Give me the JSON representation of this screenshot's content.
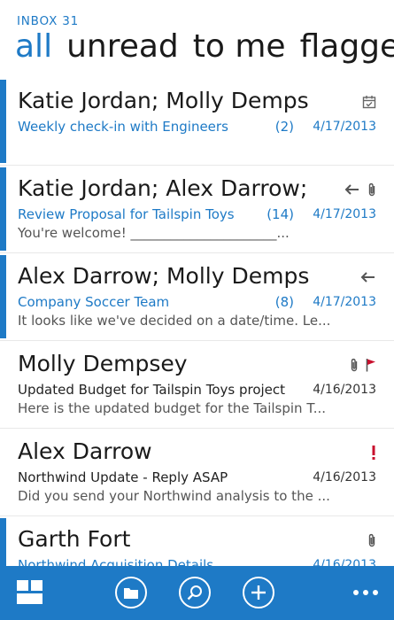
{
  "header": {
    "inbox_label": "INBOX 31",
    "pivots": [
      "all",
      "unread",
      "to me",
      "flagged"
    ]
  },
  "messages": [
    {
      "sender": "Katie Jordan; Molly Demps",
      "subject": "Weekly check-in with Engineers",
      "count": "(2)",
      "date": "4/17/2013",
      "preview": "",
      "unread": true,
      "icons": [
        "calendar-icon"
      ]
    },
    {
      "sender": "Katie Jordan; Alex Darrow;",
      "subject": "Review Proposal for Tailspin Toys",
      "count": "(14)",
      "date": "4/17/2013",
      "preview": "You're welcome! ______________________...",
      "unread": true,
      "icons": [
        "reply-icon",
        "attachment-icon"
      ]
    },
    {
      "sender": "Alex Darrow; Molly Demps",
      "subject": "Company Soccer Team",
      "count": "(8)",
      "date": "4/17/2013",
      "preview": "It looks like we've decided on a date/time.  Le...",
      "unread": true,
      "icons": [
        "reply-icon"
      ]
    },
    {
      "sender": "Molly Dempsey",
      "subject": "Updated Budget for Tailspin Toys project",
      "count": "",
      "date": "4/16/2013",
      "preview": "Here is the updated budget for the Tailspin T...",
      "unread": false,
      "icons": [
        "attachment-icon",
        "flag-icon"
      ]
    },
    {
      "sender": "Alex Darrow",
      "subject": "Northwind Update - Reply ASAP",
      "count": "",
      "date": "4/16/2013",
      "preview": "Did you send your Northwind analysis to the ...",
      "unread": false,
      "icons": [
        "high-importance-icon"
      ]
    },
    {
      "sender": "Garth Fort",
      "subject": "Northwind Acquisition Details",
      "count": "",
      "date": "4/16/2013",
      "preview": "",
      "unread": true,
      "icons": [
        "attachment-icon"
      ]
    }
  ],
  "colors": {
    "accent": "#1e7ac6",
    "flag": "#c8102e",
    "importance": "#c8102e"
  }
}
